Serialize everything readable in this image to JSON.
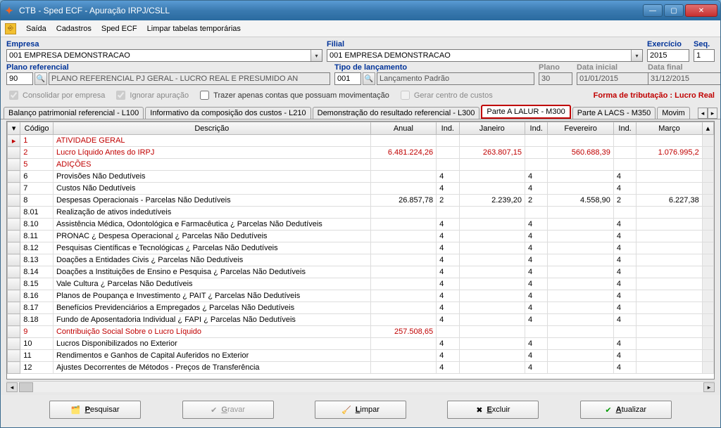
{
  "window": {
    "title": "CTB - Sped ECF - Apuração IRPJ/CSLL"
  },
  "menu": {
    "saida": "Saída",
    "cadastros": "Cadastros",
    "spedecf": "Sped ECF",
    "limpar": "Limpar tabelas temporárias"
  },
  "labels": {
    "empresa": "Empresa",
    "filial": "Filial",
    "exercicio": "Exercício",
    "seq": "Seq.",
    "plano_ref": "Plano referencial",
    "tipo_lanc": "Tipo de lançamento",
    "plano": "Plano",
    "data_inicial": "Data inicial",
    "data_final": "Data final"
  },
  "values": {
    "empresa": "001 EMPRESA DEMONSTRACAO",
    "filial": "001 EMPRESA DEMONSTRACAO",
    "exercicio": "2015",
    "seq": "1",
    "plano_ref_cod": "90",
    "plano_ref_desc": "PLANO REFERENCIAL PJ GERAL - LUCRO REAL E PRESUMIDO AN",
    "tipo_lanc_cod": "001",
    "tipo_lanc_desc": "Lançamento Padrão",
    "plano": "30",
    "data_inicial": "01/01/2015",
    "data_final": "31/12/2015"
  },
  "checks": {
    "consolidar": "Consolidar por empresa",
    "ignorar": "Ignorar apuração",
    "trazer": "Trazer apenas contas que possuam movimentação",
    "gerar": "Gerar centro de custos",
    "tributacao": "Forma de tributação : Lucro Real"
  },
  "tabs": {
    "t0": "Balanço patrimonial referencial - L100",
    "t1": "Informativo da composição dos custos - L210",
    "t2": "Demonstração do resultado referencial - L300",
    "t3": "Parte A LALUR - M300",
    "t4": "Parte A LACS - M350",
    "t5": "Movim"
  },
  "grid": {
    "headers": {
      "codigo": "Código",
      "descricao": "Descrição",
      "anual": "Anual",
      "ind": "Ind.",
      "janeiro": "Janeiro",
      "fevereiro": "Fevereiro",
      "marco": "Março"
    },
    "rows": [
      {
        "red": true,
        "cod": "1",
        "desc": "ATIVIDADE GERAL",
        "anual": "",
        "ind1": "",
        "jan": "",
        "ind2": "",
        "fev": "",
        "ind3": "",
        "mar": ""
      },
      {
        "red": true,
        "cod": "2",
        "desc": "Lucro Líquido Antes do IRPJ",
        "anual": "6.481.224,26",
        "ind1": "",
        "jan": "263.807,15",
        "ind2": "",
        "fev": "560.688,39",
        "ind3": "",
        "mar": "1.076.995,2"
      },
      {
        "red": true,
        "cod": "5",
        "desc": "ADIÇÕES",
        "anual": "",
        "ind1": "",
        "jan": "",
        "ind2": "",
        "fev": "",
        "ind3": "",
        "mar": ""
      },
      {
        "red": false,
        "cod": "6",
        "desc": "Provisões Não Dedutíveis",
        "anual": "",
        "ind1": "4",
        "jan": "",
        "ind2": "4",
        "fev": "",
        "ind3": "4",
        "mar": ""
      },
      {
        "red": false,
        "cod": "7",
        "desc": "Custos Não Dedutíveis",
        "anual": "",
        "ind1": "4",
        "jan": "",
        "ind2": "4",
        "fev": "",
        "ind3": "4",
        "mar": ""
      },
      {
        "red": false,
        "cod": "8",
        "desc": "Despesas Operacionais - Parcelas Não Dedutíveis",
        "anual": "26.857,78",
        "ind1": "2",
        "jan": "2.239,20",
        "ind2": "2",
        "fev": "4.558,90",
        "ind3": "2",
        "mar": "6.227,38"
      },
      {
        "red": false,
        "cod": "8.01",
        "desc": "Realização de ativos indedutíveis",
        "anual": "",
        "ind1": "",
        "jan": "",
        "ind2": "",
        "fev": "",
        "ind3": "",
        "mar": ""
      },
      {
        "red": false,
        "cod": "8.10",
        "desc": "Assistência Médica, Odontológica e Farmacêutica ¿ Parcelas Não Dedutíveis",
        "anual": "",
        "ind1": "4",
        "jan": "",
        "ind2": "4",
        "fev": "",
        "ind3": "4",
        "mar": ""
      },
      {
        "red": false,
        "cod": "8.11",
        "desc": "PRONAC ¿ Despesa Operacional ¿ Parcelas Não Dedutíveis",
        "anual": "",
        "ind1": "4",
        "jan": "",
        "ind2": "4",
        "fev": "",
        "ind3": "4",
        "mar": ""
      },
      {
        "red": false,
        "cod": "8.12",
        "desc": "Pesquisas Científicas e Tecnológicas ¿ Parcelas Não Dedutíveis",
        "anual": "",
        "ind1": "4",
        "jan": "",
        "ind2": "4",
        "fev": "",
        "ind3": "4",
        "mar": ""
      },
      {
        "red": false,
        "cod": "8.13",
        "desc": "Doações a Entidades Civis ¿ Parcelas Não Dedutíveis",
        "anual": "",
        "ind1": "4",
        "jan": "",
        "ind2": "4",
        "fev": "",
        "ind3": "4",
        "mar": ""
      },
      {
        "red": false,
        "cod": "8.14",
        "desc": "Doações a Instituições de Ensino e Pesquisa ¿ Parcelas Não Dedutíveis",
        "anual": "",
        "ind1": "4",
        "jan": "",
        "ind2": "4",
        "fev": "",
        "ind3": "4",
        "mar": ""
      },
      {
        "red": false,
        "cod": "8.15",
        "desc": "Vale Cultura ¿ Parcelas Não Dedutíveis",
        "anual": "",
        "ind1": "4",
        "jan": "",
        "ind2": "4",
        "fev": "",
        "ind3": "4",
        "mar": ""
      },
      {
        "red": false,
        "cod": "8.16",
        "desc": "Planos de Poupança e Investimento ¿ PAIT ¿ Parcelas Não Dedutíveis",
        "anual": "",
        "ind1": "4",
        "jan": "",
        "ind2": "4",
        "fev": "",
        "ind3": "4",
        "mar": ""
      },
      {
        "red": false,
        "cod": "8.17",
        "desc": "Benefícios Previdenciários a Empregados ¿ Parcelas Não Dedutíveis",
        "anual": "",
        "ind1": "4",
        "jan": "",
        "ind2": "4",
        "fev": "",
        "ind3": "4",
        "mar": ""
      },
      {
        "red": false,
        "cod": "8.18",
        "desc": "Fundo de Aposentadoria Individual ¿ FAPI ¿ Parcelas Não Dedutíveis",
        "anual": "",
        "ind1": "4",
        "jan": "",
        "ind2": "4",
        "fev": "",
        "ind3": "4",
        "mar": ""
      },
      {
        "red": true,
        "cod": "9",
        "desc": "Contribuição Social Sobre o Lucro Líquido",
        "anual": "257.508,65",
        "ind1": "",
        "jan": "",
        "ind2": "",
        "fev": "",
        "ind3": "",
        "mar": ""
      },
      {
        "red": false,
        "cod": "10",
        "desc": "Lucros Disponibilizados no Exterior",
        "anual": "",
        "ind1": "4",
        "jan": "",
        "ind2": "4",
        "fev": "",
        "ind3": "4",
        "mar": ""
      },
      {
        "red": false,
        "cod": "11",
        "desc": "Rendimentos e Ganhos de Capital Auferidos no Exterior",
        "anual": "",
        "ind1": "4",
        "jan": "",
        "ind2": "4",
        "fev": "",
        "ind3": "4",
        "mar": ""
      },
      {
        "red": false,
        "cod": "12",
        "desc": "Ajustes Decorrentes de Métodos - Preços de Transferência",
        "anual": "",
        "ind1": "4",
        "jan": "",
        "ind2": "4",
        "fev": "",
        "ind3": "4",
        "mar": ""
      }
    ]
  },
  "buttons": {
    "pesquisar": "Pesquisar",
    "gravar": "Gravar",
    "limpar": "Limpar",
    "excluir": "Excluir",
    "atualizar": "Atualizar"
  }
}
